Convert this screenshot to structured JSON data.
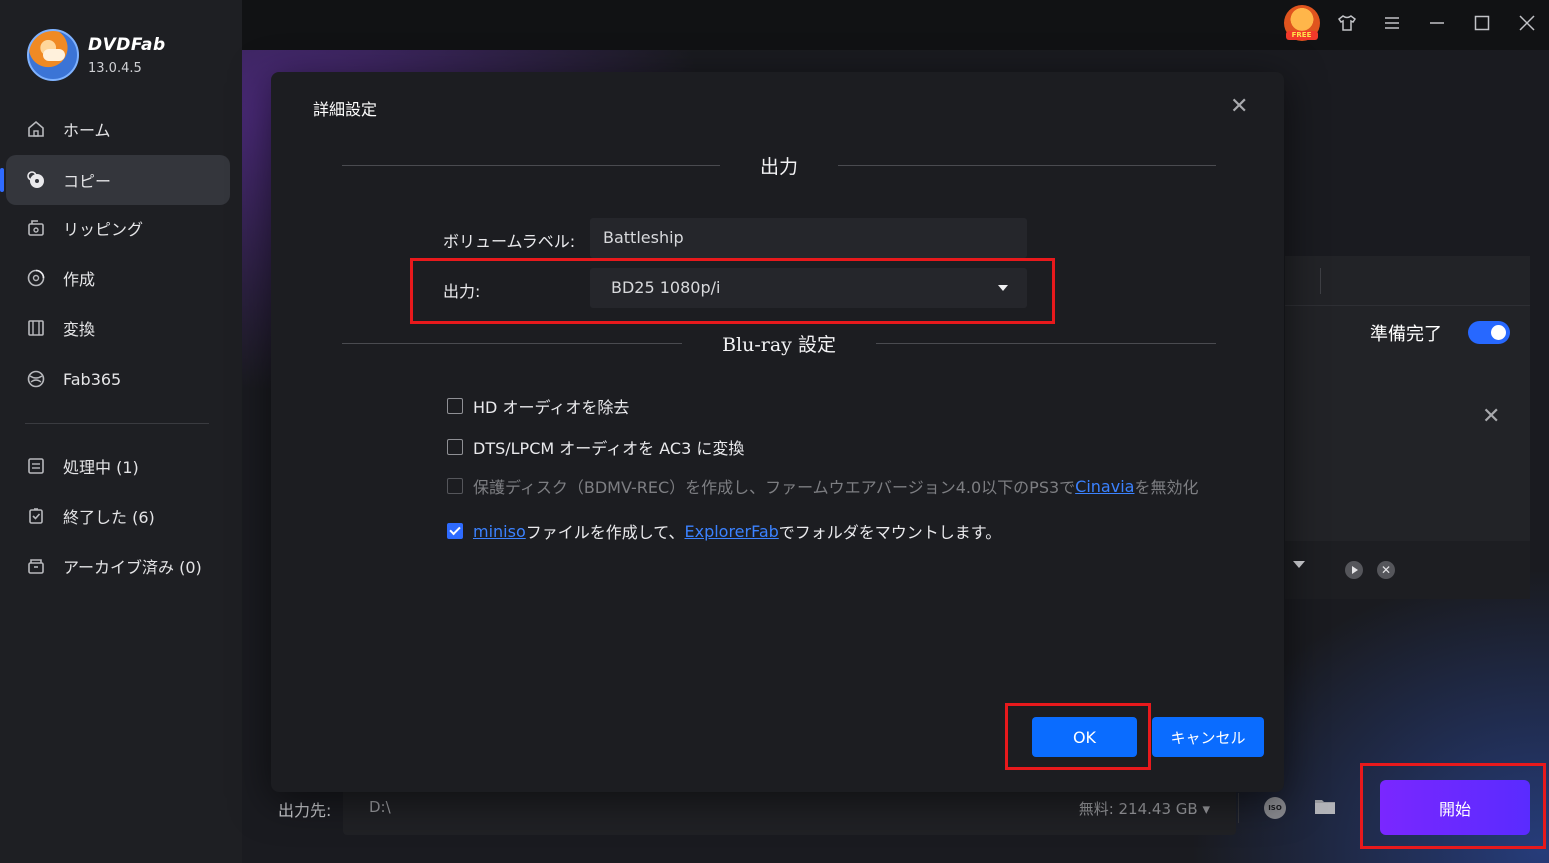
{
  "app": {
    "brand": "DVDFab",
    "version": "13.0.4.5",
    "free_badge": "FREE"
  },
  "sidebar": {
    "items": [
      {
        "label": "ホーム",
        "icon": "home-icon"
      },
      {
        "label": "コピー",
        "icon": "disc-copy-icon",
        "active": true
      },
      {
        "label": "リッピング",
        "icon": "ripper-icon"
      },
      {
        "label": "作成",
        "icon": "creator-icon"
      },
      {
        "label": "変換",
        "icon": "film-icon"
      },
      {
        "label": "Fab365",
        "icon": "fab365-icon"
      }
    ],
    "queue": [
      {
        "label": "処理中 (1)",
        "icon": "processing-icon"
      },
      {
        "label": "終了した (6)",
        "icon": "finished-icon"
      },
      {
        "label": "アーカイブ済み (0)",
        "icon": "archive-icon"
      }
    ]
  },
  "window_controls": [
    "shirt-icon",
    "menu-icon",
    "minimize-icon",
    "maximize-icon",
    "close-icon"
  ],
  "task_panel": {
    "ready_label": "準備完了",
    "ready_toggle": true
  },
  "bottom": {
    "output_label": "出力先:",
    "output_path": "D:\\",
    "free_space": "無料:  214.43 GB",
    "start_label": "開始"
  },
  "dialog": {
    "title": "詳細設定",
    "section_output": "出力",
    "volume_label_label": "ボリュームラベル:",
    "volume_label_value": "Battleship",
    "output_label": "出力:",
    "output_value": "BD25 1080p/i",
    "section_bluray": "Blu-ray 設定",
    "options": {
      "hd_audio": {
        "label": "HD オーディオを除去",
        "checked": false
      },
      "dts_lpcm": {
        "label": "DTS/LPCM オーディオを AC3 に変換",
        "checked": false
      },
      "protect_disc": {
        "prefix": "保護ディスク（BDMV-REC）を作成し、ファームウエアバージョン4.0以下のPS3で",
        "link": "Cinavia",
        "suffix": "を無効化",
        "checked": false,
        "disabled": true
      },
      "miniso": {
        "link1": "miniso",
        "middle": " ファイルを作成して、",
        "link2": "ExplorerFab",
        "suffix": "でフォルダをマウントします。",
        "checked": true
      }
    },
    "ok_label": "OK",
    "cancel_label": "キャンセル"
  },
  "colors": {
    "accent": "#0a6cff",
    "start": "#7a27ff",
    "highlight": "#e8191c"
  }
}
